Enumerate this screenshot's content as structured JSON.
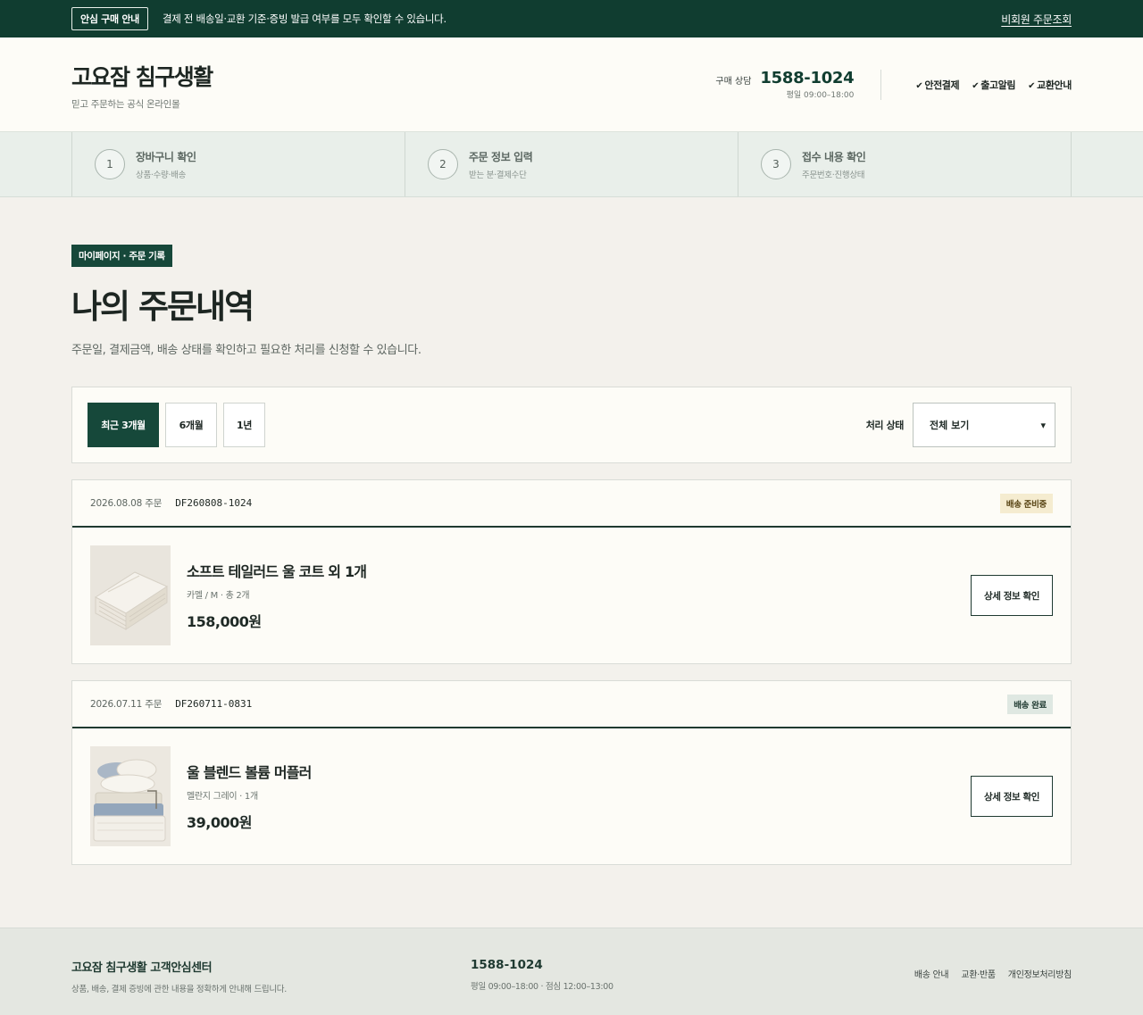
{
  "topbar": {
    "badge": "안심 구매 안내",
    "notice": "결제 전 배송일·교환 기준·증빙 발급 여부를 모두 확인할 수 있습니다.",
    "guest_link": "비회원 주문조회"
  },
  "header": {
    "brand": "고요잠 침구생활",
    "brand_sub": "믿고 주문하는 공식 온라인몰",
    "contact_label": "구매 상담",
    "contact_number": "1588-1024",
    "contact_hours": "평일 09:00–18:00",
    "assurances": [
      "안전결제",
      "출고알림",
      "교환안내"
    ]
  },
  "steps": [
    {
      "num": "1",
      "title": "장바구니 확인",
      "desc": "상품·수량·배송"
    },
    {
      "num": "2",
      "title": "주문 정보 입력",
      "desc": "받는 분·결제수단"
    },
    {
      "num": "3",
      "title": "접수 내용 확인",
      "desc": "주문번호·진행상태"
    }
  ],
  "page": {
    "tag": "마이페이지 · 주문 기록",
    "title": "나의 주문내역",
    "desc": "주문일, 결제금액, 배송 상태를 확인하고 필요한 처리를 신청할 수 있습니다."
  },
  "filter": {
    "periods": [
      "최근 3개월",
      "6개월",
      "1년"
    ],
    "active_period": "최근 3개월",
    "status_label": "처리 상태",
    "status_value": "전체 보기"
  },
  "orders": [
    {
      "date": "2026.08.08 주문",
      "order_no": "DF260808-1024",
      "status": "배송 준비중",
      "product": "소프트 테일러드 울 코트 외 1개",
      "option": "카멜 / M · 총 2개",
      "price": "158,000원",
      "action": "상세 정보 확인"
    },
    {
      "date": "2026.07.11 주문",
      "order_no": "DF260711-0831",
      "status": "배송 완료",
      "product": "울 블렌드 볼륨 머플러",
      "option": "멜란지 그레이 · 1개",
      "price": "39,000원",
      "action": "상세 정보 확인"
    }
  ],
  "footer": {
    "title": "고요잠 침구생활 고객안심센터",
    "sub": "상품, 배송, 결제 증빙에 관한 내용을 정확하게 안내해 드립니다.",
    "number": "1588-1024",
    "hours": "평일 09:00–18:00 · 점심 12:00–13:00",
    "links": [
      "배송 안내",
      "교환·반품",
      "개인정보처리방침"
    ]
  },
  "colors": {
    "brand_dark": "#103d30",
    "badge_prep_bg": "#f5ecd0",
    "badge_done_bg": "#dfe8e2"
  }
}
